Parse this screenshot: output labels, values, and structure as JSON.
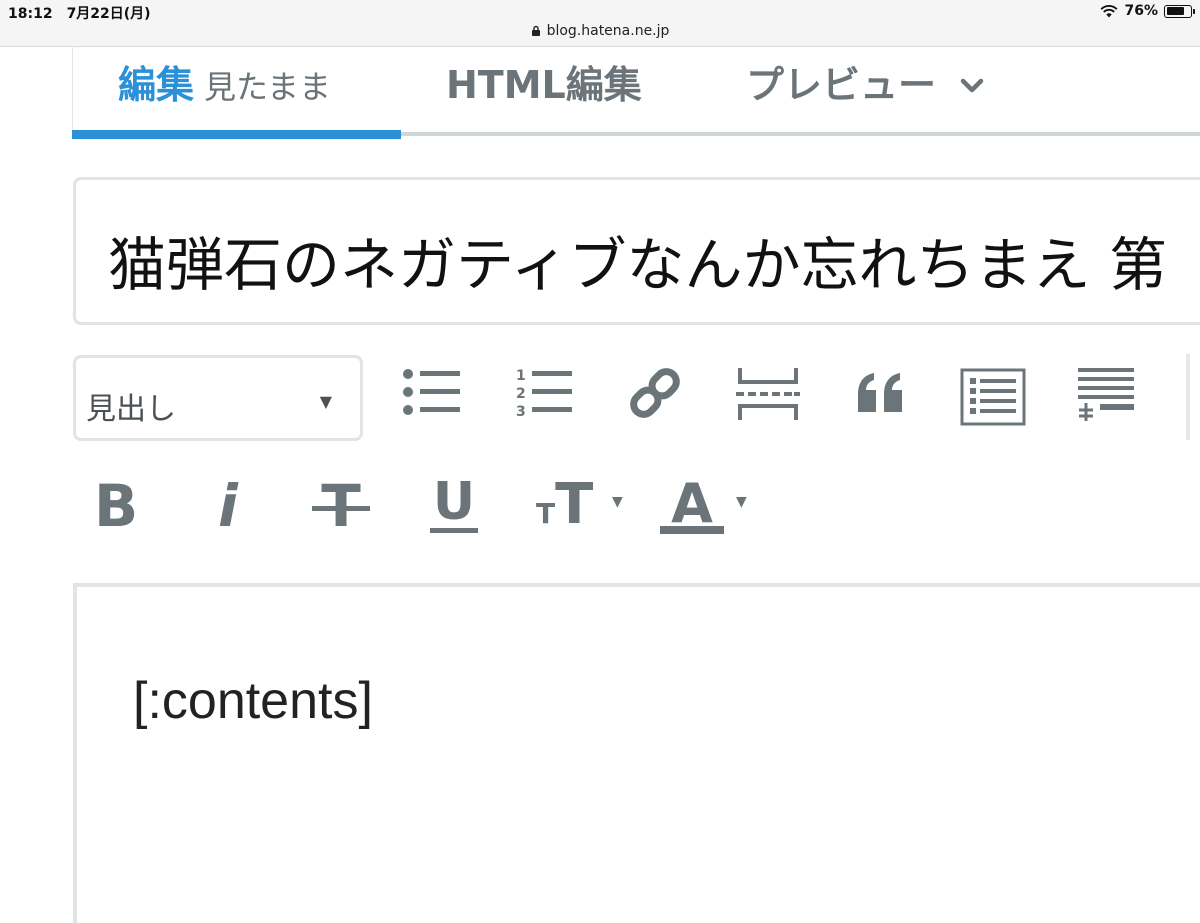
{
  "status_bar": {
    "time": "18:12　7月22日(月)",
    "url": "blog.hatena.ne.jp",
    "battery": "76%",
    "battery_level": 0.76,
    "icons": [
      "wifi-icon",
      "battery-icon",
      "lock-icon"
    ]
  },
  "tabs": {
    "edit_label": "編集",
    "edit_sub": "見たまま",
    "html_label": "HTML編集",
    "preview_label": "プレビュー",
    "active": "edit"
  },
  "title": {
    "value": "猫弾石のネガティブなんか忘れちまえ 第"
  },
  "toolbar": {
    "heading_select": "見出し",
    "icons": [
      "bullet-list-icon",
      "numbered-list-icon",
      "link-icon",
      "more-divider-icon",
      "quote-icon",
      "table-of-contents-icon",
      "footnote-icon"
    ],
    "numbered_digits": [
      "1",
      "2",
      "3"
    ]
  },
  "format": {
    "bold": "B",
    "italic": "i",
    "strike": "T",
    "underline": "U",
    "size_small": "T",
    "size_large": "T",
    "color": "A"
  },
  "editor": {
    "content": "[:contents]"
  },
  "colors": {
    "accent": "#2a90d8",
    "icon_gray": "#6b7479",
    "border": "#dfe5e7"
  }
}
